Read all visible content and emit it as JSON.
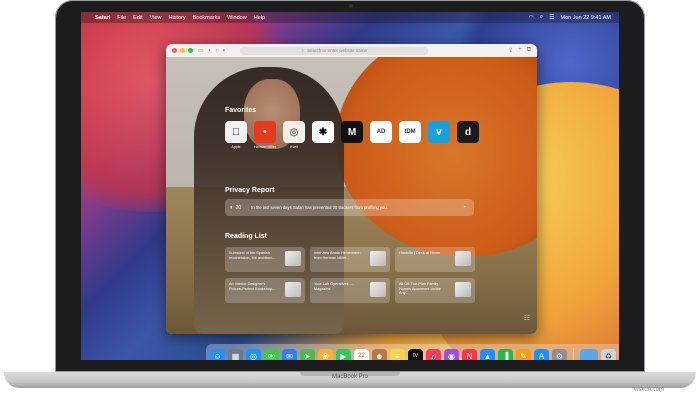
{
  "menubar": {
    "items": [
      "Safari",
      "File",
      "Edit",
      "View",
      "History",
      "Bookmarks",
      "Window",
      "Help"
    ],
    "clock": "Mon Jun 22  9:41 AM"
  },
  "toolbar": {
    "search_placeholder": "Search or enter website name"
  },
  "favorites": {
    "title": "Favorites",
    "items": [
      {
        "label": "Apple",
        "glyph": "",
        "color": "#f2f2f2",
        "fg": "#111"
      },
      {
        "label": "Herman Miller",
        "glyph": "•",
        "color": "#e63a1e",
        "fg": "#fff"
      },
      {
        "label": "Kvell",
        "glyph": "◎",
        "color": "#f0efe9",
        "fg": "#666"
      },
      {
        "label": "",
        "glyph": "✱",
        "color": "#ffffff",
        "fg": "#111"
      },
      {
        "label": "",
        "glyph": "M",
        "color": "#111111",
        "fg": "#fff"
      },
      {
        "label": "",
        "glyph": "AD",
        "color": "#ffffff",
        "fg": "#1a2a8a"
      },
      {
        "label": "",
        "glyph": "tDM",
        "color": "#ffffff",
        "fg": "#333"
      },
      {
        "label": "",
        "glyph": "v",
        "color": "#1aa0e0",
        "fg": "#fff"
      },
      {
        "label": "",
        "glyph": "d",
        "color": "#1b1b1b",
        "fg": "#fff"
      }
    ]
  },
  "privacy": {
    "title": "Privacy Report",
    "count": "20",
    "text": "In the last seven days Safari has prevented 20 trackers from profiling you."
  },
  "reading_list": {
    "title": "Reading List",
    "cards": [
      {
        "title": "Surround of the Spanish reconession, the architect..."
      },
      {
        "title": "Interview Amdo Heinemann from Herman Miller..."
      },
      {
        "title": "Hastolfo | Desk at Home"
      },
      {
        "title": "An Interior Designer's Picture-Perfect Bookshop..."
      },
      {
        "title": "Your Lab Operatives — Magazine"
      },
      {
        "title": "All Off-The-Plan Family Homes Apartment Unlike Any..."
      }
    ]
  },
  "dock": {
    "apps": [
      {
        "name": "finder",
        "glyph": "☺",
        "color": "#2a8df0"
      },
      {
        "name": "launchpad",
        "glyph": "▦",
        "color": "#6c7a8a"
      },
      {
        "name": "safari",
        "glyph": "◎",
        "color": "#1e90ff"
      },
      {
        "name": "messages",
        "glyph": "✉",
        "color": "#3ccb4a"
      },
      {
        "name": "mail",
        "glyph": "✉",
        "color": "#2f80ed"
      },
      {
        "name": "maps",
        "glyph": "➤",
        "color": "#55b35a"
      },
      {
        "name": "photos",
        "glyph": "❀",
        "color": "#f3b23c"
      },
      {
        "name": "facetime",
        "glyph": "▶",
        "color": "#34c759"
      },
      {
        "name": "calendar",
        "glyph": "22",
        "color": "#ffffff"
      },
      {
        "name": "contacts",
        "glyph": "☻",
        "color": "#b07a4a"
      },
      {
        "name": "notes",
        "glyph": "≡",
        "color": "#f7d44c"
      },
      {
        "name": "appletv",
        "glyph": "tv",
        "color": "#111111"
      },
      {
        "name": "music",
        "glyph": "♫",
        "color": "#fb3b5c"
      },
      {
        "name": "podcasts",
        "glyph": "◉",
        "color": "#9b4fd6"
      },
      {
        "name": "news",
        "glyph": "N",
        "color": "#f03a4a"
      },
      {
        "name": "keynote",
        "glyph": "▲",
        "color": "#1f8df5"
      },
      {
        "name": "numbers",
        "glyph": "▐",
        "color": "#2fb34a"
      },
      {
        "name": "pages",
        "glyph": "✎",
        "color": "#f39b1a"
      },
      {
        "name": "appstore",
        "glyph": "A",
        "color": "#1e8ff5"
      },
      {
        "name": "systempreferences",
        "glyph": "⚙",
        "color": "#8e8e93"
      }
    ],
    "folder_color": "#5aa8e8",
    "trash_glyph": "♻"
  },
  "device": {
    "label": "MacBook Pro"
  },
  "watermark": "wsxdn.com"
}
